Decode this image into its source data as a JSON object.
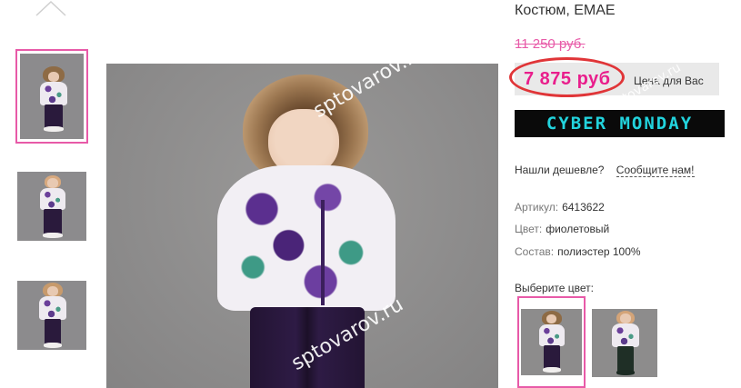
{
  "product": {
    "title": "Костюм, EMAE",
    "old_price": "11 250 руб.",
    "price": "7 875 руб",
    "price_note": "Цена для Вас"
  },
  "banner": {
    "text": "CYBER MONDAY",
    "bg": "#0a0a0a",
    "color": "#22d3dd"
  },
  "cheaper": {
    "question": "Нашли дешевле?",
    "link": "Сообщите нам!"
  },
  "attributes": [
    {
      "label": "Артикул:",
      "value": "6413622"
    },
    {
      "label": "Цвет:",
      "value": "фиолетовый"
    },
    {
      "label": "Состав:",
      "value": "полиэстер 100%"
    }
  ],
  "color_choice": {
    "label": "Выберите цвет:"
  },
  "watermark": {
    "text": "sptovarov.ru"
  },
  "thumbnails": [
    {
      "name": "thumbnail-1",
      "selected": true
    },
    {
      "name": "thumbnail-2",
      "selected": false
    },
    {
      "name": "thumbnail-3",
      "selected": false
    }
  ],
  "colors": {
    "accent_pink": "#e85aa8",
    "price_pink": "#e91e8c",
    "oval_red": "#e03538"
  },
  "icons": {
    "nav_up": "chevron-up-icon"
  }
}
